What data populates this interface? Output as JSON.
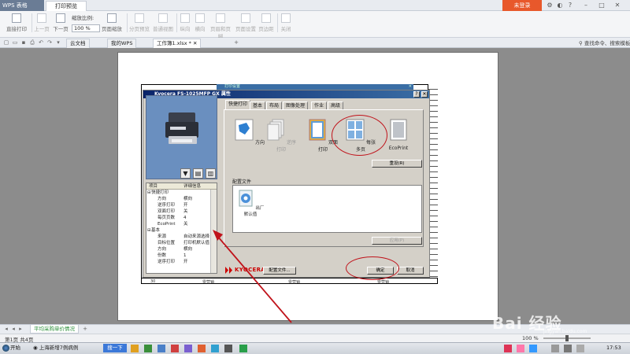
{
  "titlebar": {
    "app_name": "WPS 表格",
    "doc_tab": "打印预览",
    "login": "未登录"
  },
  "toolbar": {
    "direct_print": "直接打印",
    "prev_page": "上一页",
    "next_page": "下一页",
    "zoom_label": "缩放比例:",
    "zoom_value": "100 %",
    "page_zoom": "页面缩放",
    "page_break_preview": "分页预览",
    "normal_view": "普通视图",
    "portrait": "纵向",
    "landscape": "横向",
    "header_footer": "页眉和页脚",
    "page_setup": "页面设置",
    "margins": "页边距",
    "close": "关闭"
  },
  "doc_tabs": [
    {
      "label": "云文档"
    },
    {
      "label": "我的WPS"
    },
    {
      "label": "工作簿1.xlsx *"
    }
  ],
  "search_command": "查找命令、搜索模板",
  "dialog": {
    "underlying_title": "打印设置",
    "title": "Kyocera FS-1025MFP GX 属性",
    "tabs": [
      "快捷打印",
      "基本",
      "布局",
      "图像处理",
      "作业",
      "高级"
    ],
    "features": [
      {
        "label": "方向",
        "icon": "orientation-icon"
      },
      {
        "label": "逆序打印",
        "icon": "reverse-print-icon"
      },
      {
        "label": "双面打印",
        "icon": "duplex-icon"
      },
      {
        "label": "每张多页",
        "icon": "pages-per-sheet-icon"
      },
      {
        "label": "EcoPrint",
        "icon": "ecoprint-icon"
      }
    ],
    "reset_button": "重设(R)",
    "config_label": "配置文件",
    "config_item": "出厂默认值",
    "apply_button": "应用(P)",
    "config_button": "配置文件...",
    "ok_button": "确定",
    "cancel_button": "取消",
    "brand": "KYOCERA",
    "settings_head": {
      "item": "项目",
      "detail": "详细信息"
    },
    "settings_rows": [
      {
        "key": "快捷打印",
        "value": "",
        "group": true
      },
      {
        "key": "方向",
        "value": "横向",
        "group": false
      },
      {
        "key": "逆序打印",
        "value": "开",
        "group": false
      },
      {
        "key": "双面打印",
        "value": "关",
        "group": false
      },
      {
        "key": "每页页数",
        "value": "4",
        "group": false
      },
      {
        "key": "EcoPrint",
        "value": "关",
        "group": false
      },
      {
        "key": "基本",
        "value": "",
        "group": true
      },
      {
        "key": "来源",
        "value": "自动来源选择",
        "group": false
      },
      {
        "key": "目标位置",
        "value": "打印机默认值",
        "group": false
      },
      {
        "key": "方向",
        "value": "横向",
        "group": false
      },
      {
        "key": "份数",
        "value": "1",
        "group": false
      },
      {
        "key": "逆序打印",
        "value": "开",
        "group": false
      }
    ]
  },
  "sheet": {
    "bottom_cells": [
      "30",
      "零营销",
      "零营销",
      "零营销"
    ]
  },
  "sheet_tab": "平均采购单价情况",
  "status": {
    "page": "第1页 共4页",
    "zoom": "100 %"
  },
  "taskbar": {
    "start": "开始",
    "task1": "上海新增7例病例",
    "search_btn": "搜一下",
    "clock": "17:53"
  },
  "watermark": {
    "text": "Bai 经验",
    "sub": "jingyan.baidu.com"
  },
  "colors": {
    "annotation_red": "#c0131b",
    "title_blue": "#0a246a",
    "login_orange": "#e8582b"
  }
}
